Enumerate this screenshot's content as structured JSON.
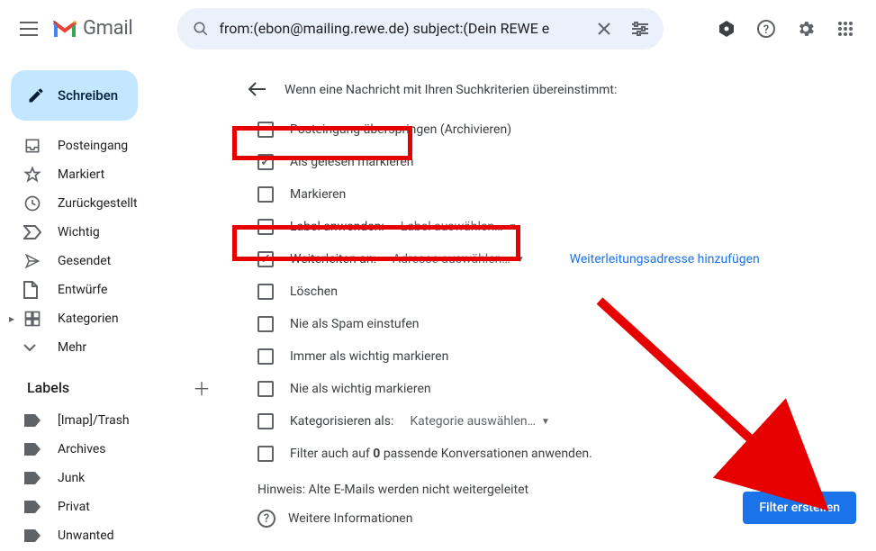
{
  "header": {
    "app_name": "Gmail",
    "search_value": "from:(ebon@mailing.rewe.de) subject:(Dein REWE e"
  },
  "sidebar": {
    "compose_label": "Schreiben",
    "items": [
      {
        "label": "Posteingang"
      },
      {
        "label": "Markiert"
      },
      {
        "label": "Zurückgestellt"
      },
      {
        "label": "Wichtig"
      },
      {
        "label": "Gesendet"
      },
      {
        "label": "Entwürfe"
      },
      {
        "label": "Kategorien"
      },
      {
        "label": "Mehr"
      }
    ],
    "labels_header": "Labels",
    "labels": [
      {
        "label": "[Imap]/Trash"
      },
      {
        "label": "Archives"
      },
      {
        "label": "Junk"
      },
      {
        "label": "Privat"
      },
      {
        "label": "Unwanted"
      }
    ]
  },
  "dialog": {
    "title": "Wenn eine Nachricht mit Ihren Suchkriterien übereinstimmt:",
    "options": {
      "skip_inbox": "Posteingang überspringen (Archivieren)",
      "mark_read": "Als gelesen markieren",
      "star": "Markieren",
      "apply_label": "Label anwenden:",
      "apply_label_select": "Label auswählen…",
      "forward": "Weiterleiten an:",
      "forward_select": "Adresse auswählen…",
      "add_forward_link": "Weiterleitungsadresse hinzufügen",
      "delete": "Löschen",
      "never_spam": "Nie als Spam einstufen",
      "always_important": "Immer als wichtig markieren",
      "never_important": "Nie als wichtig markieren",
      "categorize": "Kategorisieren als:",
      "categorize_select": "Kategorie auswählen…",
      "also_apply_pre": "Filter auch auf ",
      "also_apply_count": "0",
      "also_apply_post": " passende Konversationen anwenden."
    },
    "hint": "Hinweis: Alte E-Mails werden nicht weitergeleitet",
    "more_info": "Weitere Informationen",
    "create_button": "Filter erstellen"
  }
}
